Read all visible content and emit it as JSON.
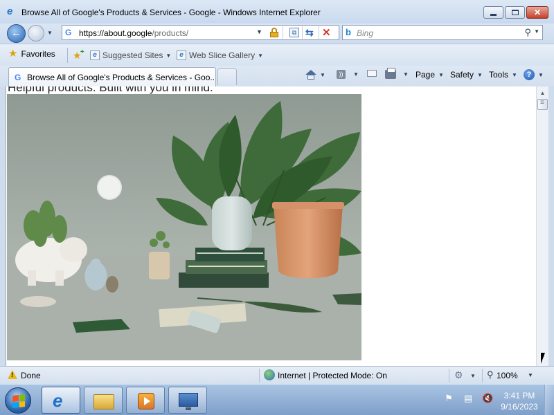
{
  "window": {
    "title": "Browse All of Google's Products & Services - Google - Windows Internet Explorer",
    "app_icon": "ie-icon"
  },
  "nav": {
    "url_host": "https://about.google",
    "url_path": "/products/",
    "search_placeholder": "Bing",
    "back_icon": "back-arrow-icon",
    "forward_icon": "forward-arrow-icon"
  },
  "favorites_bar": {
    "favorites_label": "Favorites",
    "links": [
      {
        "label": "Suggested Sites"
      },
      {
        "label": "Web Slice Gallery"
      }
    ]
  },
  "tab": {
    "label": "Browse All of Google's Products & Services - Goo..."
  },
  "commands": {
    "page": "Page",
    "safety": "Safety",
    "tools": "Tools"
  },
  "content": {
    "headline": "Helpful products. Built with you in mind.",
    "image_description": "Google devices and plants"
  },
  "status_bar": {
    "status": "Done",
    "zone": "Internet | Protected Mode: On",
    "zoom": "100%"
  },
  "taskbar": {
    "time": "3:41 PM",
    "date": "9/16/2023",
    "apps": [
      "internet-explorer",
      "windows-explorer",
      "media-player",
      "remote-desktop"
    ]
  },
  "colors": {
    "chrome_blue": "#cfdcec",
    "close_red": "#c5412b",
    "taskbar": "#7e9fc9"
  }
}
